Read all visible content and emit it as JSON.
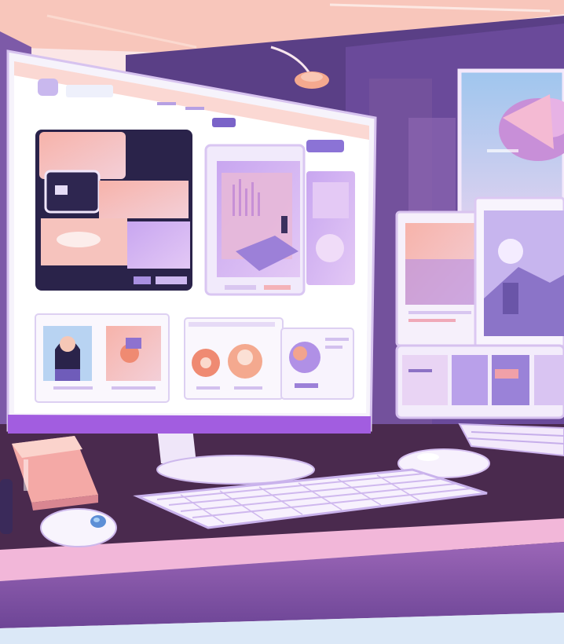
{
  "scene": {
    "description_name": "illustrated-desk-setup",
    "palette": {
      "ceiling": "#f9c9be",
      "wall_dark": "#5a3f86",
      "wall_mid": "#7a5aa8",
      "desk_top": "#4a2a4e",
      "desk_front": "#8a5aa8",
      "desk_edge": "#f2b7d9",
      "floor": "#dbe8f7",
      "monitor_frame": "#f6f3fb",
      "monitor_bezel_bottom": "#a25de0",
      "accent_pink": "#f6a9a6",
      "accent_purple": "#b48ee6",
      "accent_coral": "#ef8a72",
      "accent_navy": "#2a234a",
      "screen_white": "#ffffff"
    },
    "icons": [
      "mouse-icon",
      "lamp-icon",
      "keyboard-icon"
    ]
  }
}
